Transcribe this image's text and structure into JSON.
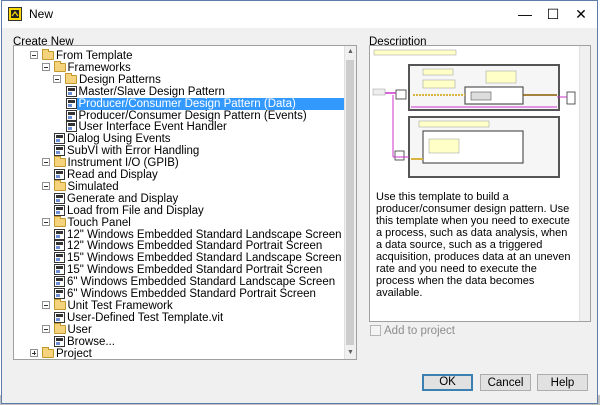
{
  "window": {
    "title": "New",
    "close_glyph": "✕",
    "max_glyph": "☐",
    "min_glyph": "—"
  },
  "left": {
    "header": "Create New",
    "tree": [
      {
        "label": "From Template",
        "kind": "folder",
        "exp": "-",
        "level": 1,
        "selected": false
      },
      {
        "label": "Frameworks",
        "kind": "folder",
        "exp": "-",
        "level": 2,
        "selected": false
      },
      {
        "label": "Design Patterns",
        "kind": "folder",
        "exp": "-",
        "level": 3,
        "selected": false
      },
      {
        "label": "Master/Slave Design Pattern",
        "kind": "vi",
        "exp": "",
        "level": 4,
        "selected": false
      },
      {
        "label": "Producer/Consumer Design Pattern (Data)",
        "kind": "vi",
        "exp": "",
        "level": 4,
        "selected": true
      },
      {
        "label": "Producer/Consumer Design Pattern (Events)",
        "kind": "vi",
        "exp": "",
        "level": 4,
        "selected": false
      },
      {
        "label": "User Interface Event Handler",
        "kind": "vi",
        "exp": "",
        "level": 4,
        "selected": false
      },
      {
        "label": "Dialog Using Events",
        "kind": "vi",
        "exp": "",
        "level": 3,
        "selected": false
      },
      {
        "label": "SubVI with Error Handling",
        "kind": "vi",
        "exp": "",
        "level": 3,
        "selected": false
      },
      {
        "label": "Instrument I/O (GPIB)",
        "kind": "folder",
        "exp": "-",
        "level": 2,
        "selected": false
      },
      {
        "label": "Read and Display",
        "kind": "vi",
        "exp": "",
        "level": 3,
        "selected": false
      },
      {
        "label": "Simulated",
        "kind": "folder",
        "exp": "-",
        "level": 2,
        "selected": false
      },
      {
        "label": "Generate and Display",
        "kind": "vi",
        "exp": "",
        "level": 3,
        "selected": false
      },
      {
        "label": "Load from File and Display",
        "kind": "vi",
        "exp": "",
        "level": 3,
        "selected": false
      },
      {
        "label": "Touch Panel",
        "kind": "folder",
        "exp": "-",
        "level": 2,
        "selected": false
      },
      {
        "label": "12\" Windows Embedded Standard Landscape Screen",
        "kind": "vi",
        "exp": "",
        "level": 3,
        "selected": false
      },
      {
        "label": "12\" Windows Embedded Standard Portrait Screen",
        "kind": "vi",
        "exp": "",
        "level": 3,
        "selected": false
      },
      {
        "label": "15\" Windows Embedded Standard Landscape Screen",
        "kind": "vi",
        "exp": "",
        "level": 3,
        "selected": false
      },
      {
        "label": "15\" Windows Embedded Standard Portrait Screen",
        "kind": "vi",
        "exp": "",
        "level": 3,
        "selected": false
      },
      {
        "label": "6\" Windows Embedded Standard Landscape Screen",
        "kind": "vi",
        "exp": "",
        "level": 3,
        "selected": false
      },
      {
        "label": "6\" Windows Embedded Standard Portrait Screen",
        "kind": "vi",
        "exp": "",
        "level": 3,
        "selected": false
      },
      {
        "label": "Unit Test Framework",
        "kind": "folder",
        "exp": "-",
        "level": 2,
        "selected": false
      },
      {
        "label": "User-Defined Test Template.vit",
        "kind": "vi",
        "exp": "",
        "level": 3,
        "selected": false
      },
      {
        "label": "User",
        "kind": "folder",
        "exp": "-",
        "level": 2,
        "selected": false
      },
      {
        "label": "Browse...",
        "kind": "vi",
        "exp": "",
        "level": 3,
        "selected": false
      },
      {
        "label": "Project",
        "kind": "folder",
        "exp": "+",
        "level": 1,
        "selected": false
      }
    ]
  },
  "right": {
    "header": "Description",
    "text": "Use this template to build a producer/consumer design pattern. Use this template when you need to execute a process, such as data analysis, when a data source, such as a triggered acquisition, produces data at an uneven rate and you need to execute the process when the data becomes available.",
    "checkbox_label": "Add to project",
    "checkbox_checked": false
  },
  "buttons": {
    "ok": "OK",
    "cancel": "Cancel",
    "help": "Help"
  },
  "colors": {
    "selection": "#3399ff",
    "accent_border": "#3c7fb1"
  }
}
